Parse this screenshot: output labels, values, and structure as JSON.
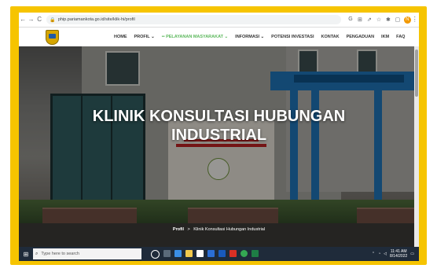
{
  "browser": {
    "url": "phip.pariamankota.go.id/site/klik-hi/profil",
    "nav_back": "←",
    "nav_forward": "→",
    "nav_reload": "C",
    "profile_initial": "N"
  },
  "site_nav": {
    "items": [
      {
        "label": "HOME"
      },
      {
        "label": "PROFIL ⌄"
      },
      {
        "label": "•• PELAYANAN MASYARAKAT ⌄",
        "active": true
      },
      {
        "label": "INFORMASI ⌄"
      },
      {
        "label": "POTENSI INVESTASI"
      },
      {
        "label": "KONTAK"
      },
      {
        "label": "PENGADUAN"
      },
      {
        "label": "IKM"
      },
      {
        "label": "FAQ"
      }
    ]
  },
  "hero": {
    "title_line1": "KLINIK KONSULTASI HUBUNGAN",
    "title_line2": "INDUSTRIAL"
  },
  "breadcrumb": {
    "home": "Profil",
    "separator": ">",
    "current": "Klinik Konsultasi Hubungan Industrial"
  },
  "taskbar": {
    "search_placeholder": "Type here to search",
    "time": "11:41 AM",
    "date": "8/14/2022"
  },
  "colors": {
    "frame": "#f6c400",
    "nav_active": "#5cb85c",
    "taskbar": "#1f2b3a"
  }
}
